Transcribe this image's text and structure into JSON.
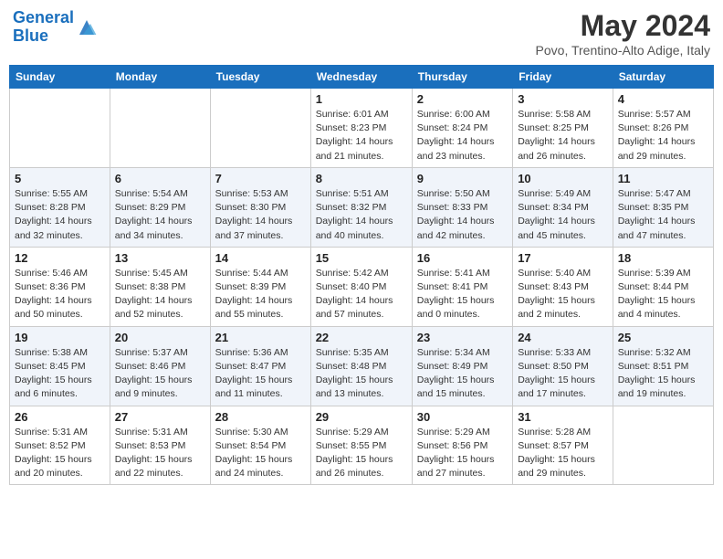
{
  "header": {
    "logo_line1": "General",
    "logo_line2": "Blue",
    "title": "May 2024",
    "subtitle": "Povo, Trentino-Alto Adige, Italy"
  },
  "days_of_week": [
    "Sunday",
    "Monday",
    "Tuesday",
    "Wednesday",
    "Thursday",
    "Friday",
    "Saturday"
  ],
  "weeks": [
    [
      {
        "num": "",
        "detail": ""
      },
      {
        "num": "",
        "detail": ""
      },
      {
        "num": "",
        "detail": ""
      },
      {
        "num": "1",
        "detail": "Sunrise: 6:01 AM\nSunset: 8:23 PM\nDaylight: 14 hours and 21 minutes."
      },
      {
        "num": "2",
        "detail": "Sunrise: 6:00 AM\nSunset: 8:24 PM\nDaylight: 14 hours and 23 minutes."
      },
      {
        "num": "3",
        "detail": "Sunrise: 5:58 AM\nSunset: 8:25 PM\nDaylight: 14 hours and 26 minutes."
      },
      {
        "num": "4",
        "detail": "Sunrise: 5:57 AM\nSunset: 8:26 PM\nDaylight: 14 hours and 29 minutes."
      }
    ],
    [
      {
        "num": "5",
        "detail": "Sunrise: 5:55 AM\nSunset: 8:28 PM\nDaylight: 14 hours and 32 minutes."
      },
      {
        "num": "6",
        "detail": "Sunrise: 5:54 AM\nSunset: 8:29 PM\nDaylight: 14 hours and 34 minutes."
      },
      {
        "num": "7",
        "detail": "Sunrise: 5:53 AM\nSunset: 8:30 PM\nDaylight: 14 hours and 37 minutes."
      },
      {
        "num": "8",
        "detail": "Sunrise: 5:51 AM\nSunset: 8:32 PM\nDaylight: 14 hours and 40 minutes."
      },
      {
        "num": "9",
        "detail": "Sunrise: 5:50 AM\nSunset: 8:33 PM\nDaylight: 14 hours and 42 minutes."
      },
      {
        "num": "10",
        "detail": "Sunrise: 5:49 AM\nSunset: 8:34 PM\nDaylight: 14 hours and 45 minutes."
      },
      {
        "num": "11",
        "detail": "Sunrise: 5:47 AM\nSunset: 8:35 PM\nDaylight: 14 hours and 47 minutes."
      }
    ],
    [
      {
        "num": "12",
        "detail": "Sunrise: 5:46 AM\nSunset: 8:36 PM\nDaylight: 14 hours and 50 minutes."
      },
      {
        "num": "13",
        "detail": "Sunrise: 5:45 AM\nSunset: 8:38 PM\nDaylight: 14 hours and 52 minutes."
      },
      {
        "num": "14",
        "detail": "Sunrise: 5:44 AM\nSunset: 8:39 PM\nDaylight: 14 hours and 55 minutes."
      },
      {
        "num": "15",
        "detail": "Sunrise: 5:42 AM\nSunset: 8:40 PM\nDaylight: 14 hours and 57 minutes."
      },
      {
        "num": "16",
        "detail": "Sunrise: 5:41 AM\nSunset: 8:41 PM\nDaylight: 15 hours and 0 minutes."
      },
      {
        "num": "17",
        "detail": "Sunrise: 5:40 AM\nSunset: 8:43 PM\nDaylight: 15 hours and 2 minutes."
      },
      {
        "num": "18",
        "detail": "Sunrise: 5:39 AM\nSunset: 8:44 PM\nDaylight: 15 hours and 4 minutes."
      }
    ],
    [
      {
        "num": "19",
        "detail": "Sunrise: 5:38 AM\nSunset: 8:45 PM\nDaylight: 15 hours and 6 minutes."
      },
      {
        "num": "20",
        "detail": "Sunrise: 5:37 AM\nSunset: 8:46 PM\nDaylight: 15 hours and 9 minutes."
      },
      {
        "num": "21",
        "detail": "Sunrise: 5:36 AM\nSunset: 8:47 PM\nDaylight: 15 hours and 11 minutes."
      },
      {
        "num": "22",
        "detail": "Sunrise: 5:35 AM\nSunset: 8:48 PM\nDaylight: 15 hours and 13 minutes."
      },
      {
        "num": "23",
        "detail": "Sunrise: 5:34 AM\nSunset: 8:49 PM\nDaylight: 15 hours and 15 minutes."
      },
      {
        "num": "24",
        "detail": "Sunrise: 5:33 AM\nSunset: 8:50 PM\nDaylight: 15 hours and 17 minutes."
      },
      {
        "num": "25",
        "detail": "Sunrise: 5:32 AM\nSunset: 8:51 PM\nDaylight: 15 hours and 19 minutes."
      }
    ],
    [
      {
        "num": "26",
        "detail": "Sunrise: 5:31 AM\nSunset: 8:52 PM\nDaylight: 15 hours and 20 minutes."
      },
      {
        "num": "27",
        "detail": "Sunrise: 5:31 AM\nSunset: 8:53 PM\nDaylight: 15 hours and 22 minutes."
      },
      {
        "num": "28",
        "detail": "Sunrise: 5:30 AM\nSunset: 8:54 PM\nDaylight: 15 hours and 24 minutes."
      },
      {
        "num": "29",
        "detail": "Sunrise: 5:29 AM\nSunset: 8:55 PM\nDaylight: 15 hours and 26 minutes."
      },
      {
        "num": "30",
        "detail": "Sunrise: 5:29 AM\nSunset: 8:56 PM\nDaylight: 15 hours and 27 minutes."
      },
      {
        "num": "31",
        "detail": "Sunrise: 5:28 AM\nSunset: 8:57 PM\nDaylight: 15 hours and 29 minutes."
      },
      {
        "num": "",
        "detail": ""
      }
    ]
  ]
}
